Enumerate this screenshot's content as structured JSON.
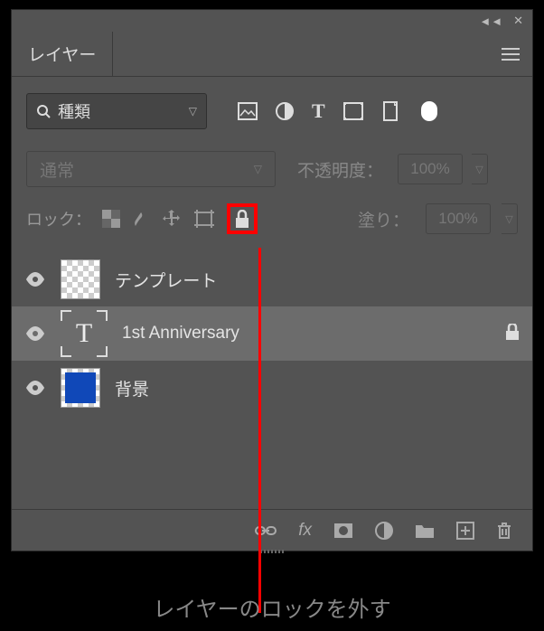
{
  "topbar": {
    "collapse": "◄◄",
    "close": "✕"
  },
  "panel": {
    "tab_title": "レイヤー"
  },
  "filter": {
    "search_label": "種類",
    "icons": [
      "image-icon",
      "adjustment-icon",
      "type-icon",
      "shape-icon",
      "smartobject-icon"
    ]
  },
  "blend": {
    "mode": "通常",
    "opacity_label": "不透明度：",
    "opacity_value": "100%"
  },
  "lock": {
    "label": "ロック：",
    "fill_label": "塗り：",
    "fill_value": "100%"
  },
  "layers": [
    {
      "name": "テンプレート",
      "type": "image",
      "visible": true,
      "locked": false,
      "selected": false
    },
    {
      "name": "1st Anniversary",
      "type": "text",
      "visible": true,
      "locked": true,
      "selected": true
    },
    {
      "name": "背景",
      "type": "solid",
      "visible": true,
      "locked": false,
      "selected": false
    }
  ],
  "caption": "レイヤーのロックを外す"
}
